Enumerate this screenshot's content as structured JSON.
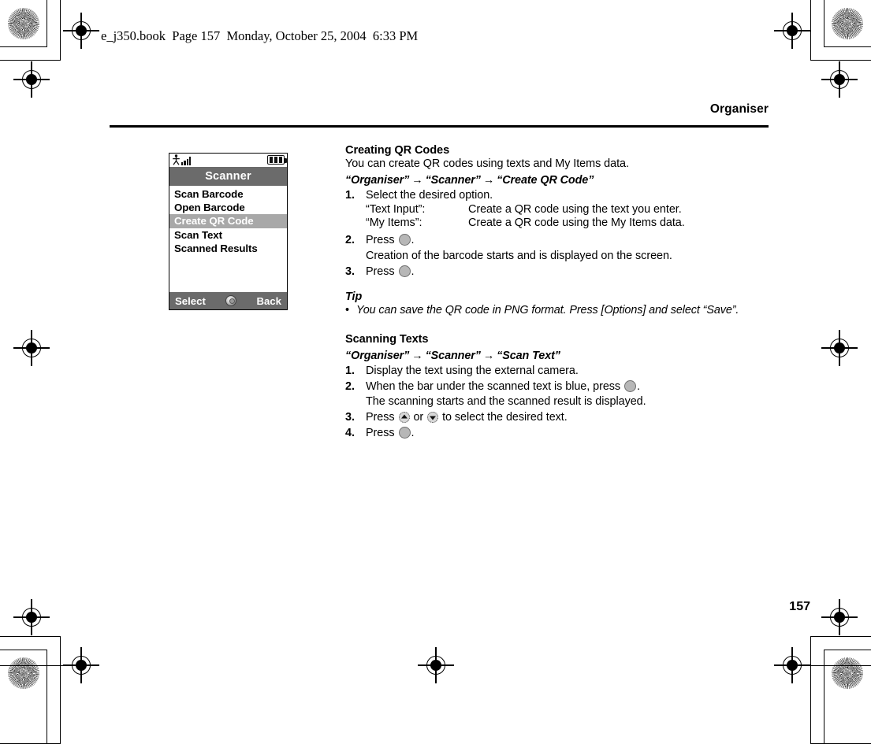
{
  "print": {
    "filestamp": "e_j350.book  Page 157  Monday, October 25, 2004  6:33 PM",
    "running_head": "Organiser",
    "folio": "157"
  },
  "phone": {
    "status": {
      "antenna_icon": "antenna-signal-icon",
      "battery_icon": "battery-full-icon"
    },
    "title": "Scanner",
    "menu": [
      {
        "label": "Scan Barcode",
        "selected": false
      },
      {
        "label": "Open Barcode",
        "selected": false
      },
      {
        "label": "Create QR Code",
        "selected": true
      },
      {
        "label": "Scan Text",
        "selected": false
      },
      {
        "label": "Scanned Results",
        "selected": false
      }
    ],
    "softkeys": {
      "left": "Select",
      "center_icon": "center-key-icon",
      "right": "Back"
    },
    "colors": {
      "title_bar": "#6b6b6b",
      "highlight": "#a8a8a8",
      "soft_bar": "#6b6b6b"
    }
  },
  "sections": [
    {
      "heading": "Creating QR Codes",
      "intro": "You can create QR codes using texts and My Items data.",
      "path": [
        "“Organiser”",
        "“Scanner”",
        "“Create QR Code”"
      ],
      "steps": [
        {
          "num": "1.",
          "text": "Select the desired option."
        },
        {
          "num": "2.",
          "text_before": "Press",
          "key": "center-key-round",
          "text_after": "."
        },
        {
          "num": "3.",
          "text_before": "Press",
          "key": "center-key-round",
          "text_after": "."
        }
      ],
      "definitions": [
        {
          "term": "“Text Input”:",
          "desc": "Create a QR code using the text you enter."
        },
        {
          "term": "“My Items”:",
          "desc": "Create a QR code using the My Items data."
        }
      ],
      "note_after_step2": "Creation of the barcode starts and is displayed on the screen.",
      "tip_heading": "Tip",
      "tip_bullet": "•",
      "tip_text": "You can save the QR code in PNG format. Press [Options] and select “Save”."
    },
    {
      "heading": "Scanning Texts",
      "path": [
        "“Organiser”",
        "“Scanner”",
        "“Scan Text”"
      ],
      "steps": [
        {
          "num": "1.",
          "text": "Display the text using the external camera."
        },
        {
          "num": "2.",
          "text_before": "When the bar under the scanned text is blue, press",
          "key": "center-key-round",
          "text_after": "."
        },
        {
          "num": "3.",
          "text_before": "Press",
          "key_up": "up-arrow-key",
          "conj": "or",
          "key_down": "down-arrow-key",
          "text_after": "to select the desired text."
        },
        {
          "num": "4.",
          "text_before": "Press",
          "key": "center-key-round",
          "text_after": "."
        }
      ],
      "note_after_step2": "The scanning starts and the scanned result is displayed."
    }
  ],
  "arrow_separator": "→"
}
